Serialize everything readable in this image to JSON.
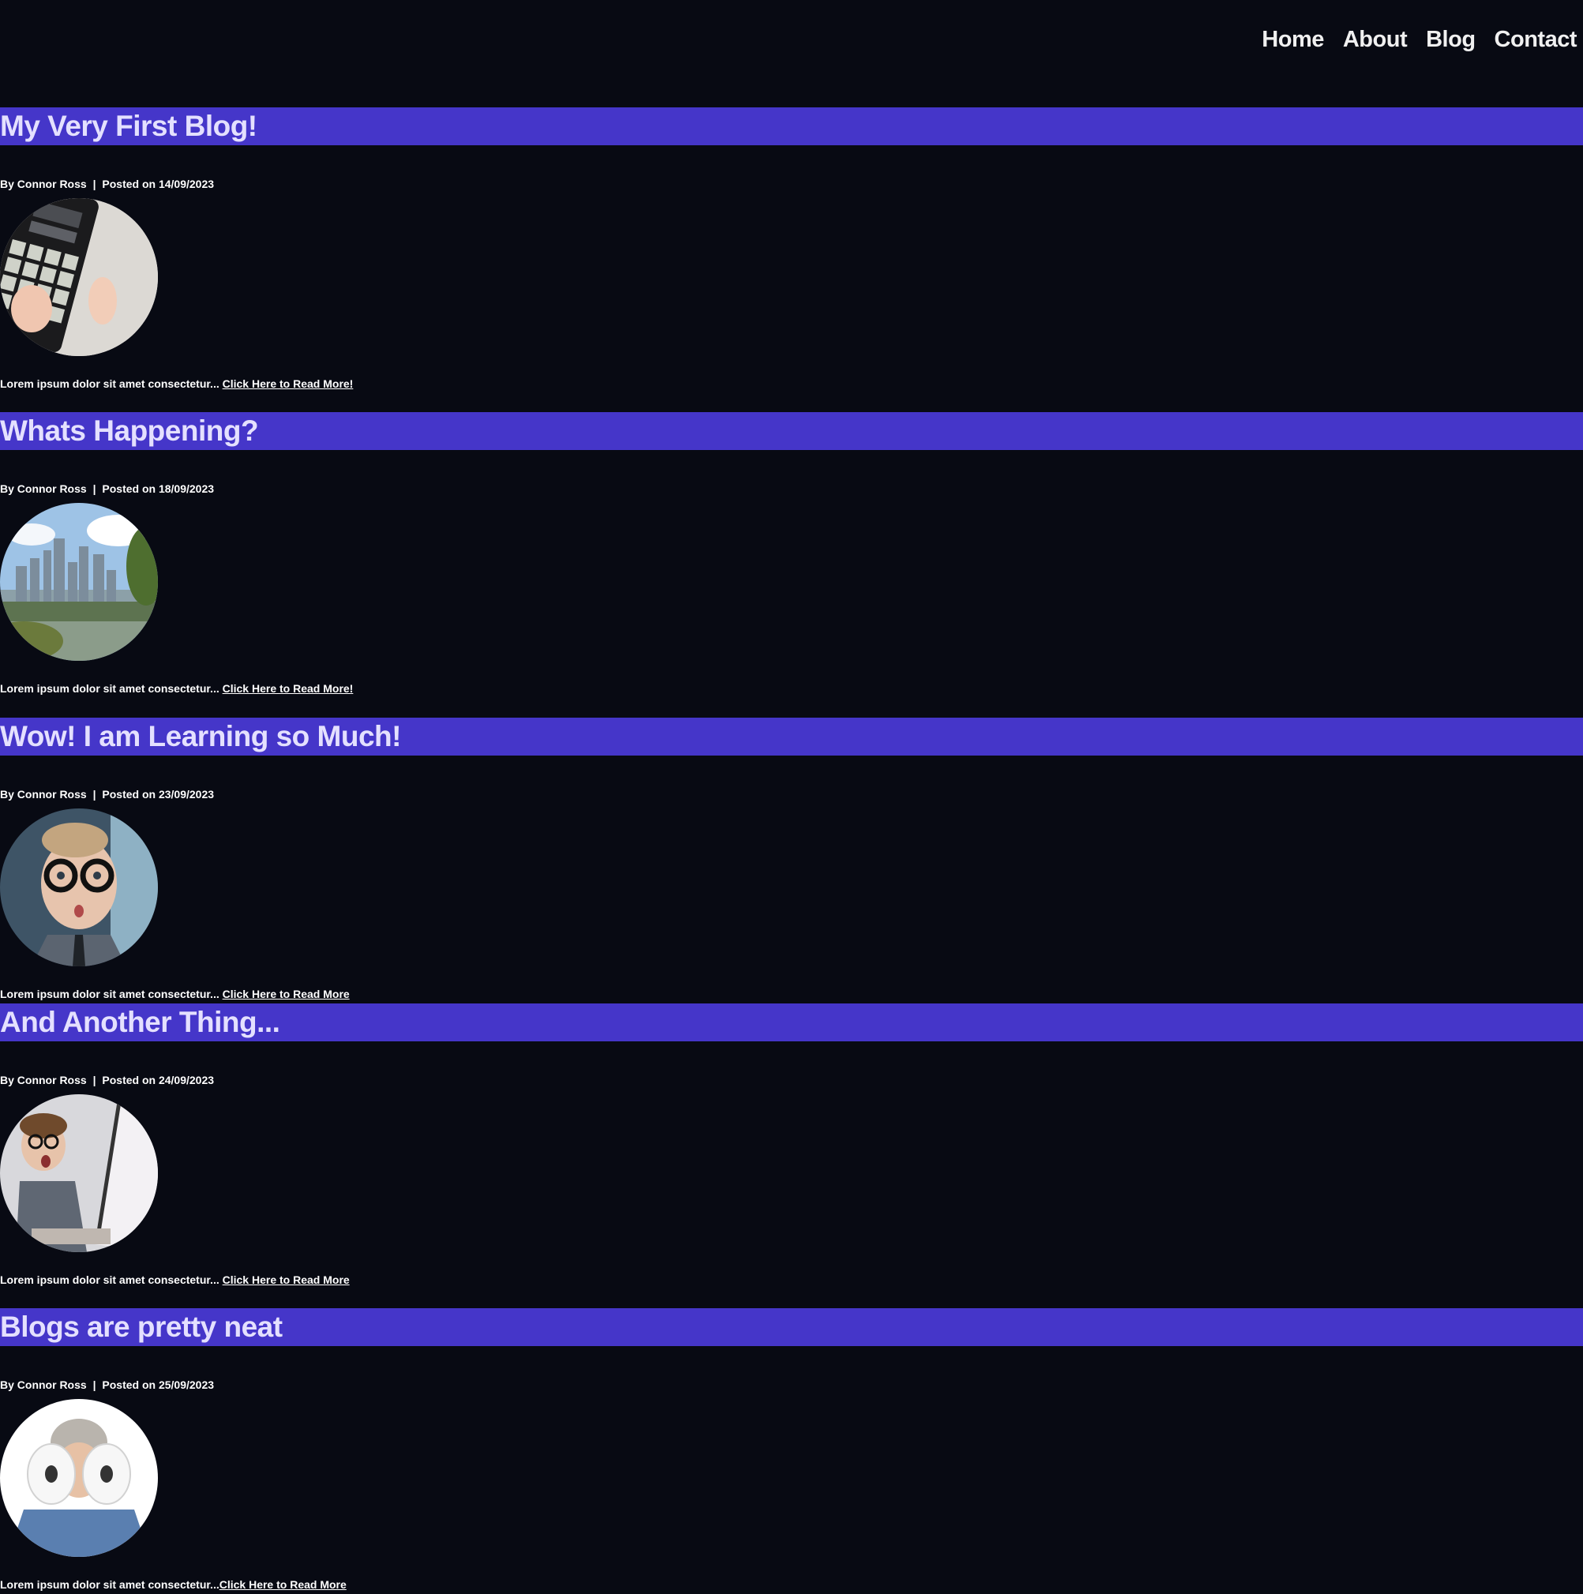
{
  "nav": {
    "items": [
      "Home",
      "About",
      "Blog",
      "Contact"
    ]
  },
  "posts": [
    {
      "title": "My Very First Blog!",
      "author": "By Connor Ross",
      "separator": "|",
      "date": "Posted on 14/09/2023",
      "image": "beat-pad-controller-photo",
      "excerpt": "Lorem ipsum dolor sit amet consectetur...",
      "read_more": "Click Here to Read More!"
    },
    {
      "title": "Whats Happening?",
      "author": "By Connor Ross",
      "separator": "|",
      "date": "Posted on 18/09/2023",
      "image": "city-skyline-river-photo",
      "excerpt": "Lorem ipsum dolor sit amet consectetur...",
      "read_more": "Click Here to Read More!"
    },
    {
      "title": "Wow! I am Learning so Much!",
      "author": "By Connor Ross",
      "separator": "|",
      "date": "Posted on 23/09/2023",
      "image": "child-with-glasses-photo",
      "excerpt": "Lorem ipsum dolor sit amet consectetur...",
      "read_more": "Click Here to Read More"
    },
    {
      "title": "And Another Thing...",
      "author": "By Connor Ross",
      "separator": "|",
      "date": "Posted on 24/09/2023",
      "image": "child-at-laptop-photo",
      "excerpt": "Lorem ipsum dolor sit amet consectetur...",
      "read_more": "Click Here to Read More"
    },
    {
      "title": "Blogs are pretty neat",
      "author": "By Connor Ross",
      "separator": "|",
      "date": "Posted on 25/09/2023",
      "image": "toilet-roll-binoculars-photo",
      "excerpt": "Lorem ipsum dolor sit amet consectetur...",
      "read_more": "Click Here to Read More"
    }
  ],
  "colors": {
    "background": "#080a13",
    "title_bar": "#4536c9",
    "title_text": "#e4e0ff",
    "text": "#ffffff"
  }
}
